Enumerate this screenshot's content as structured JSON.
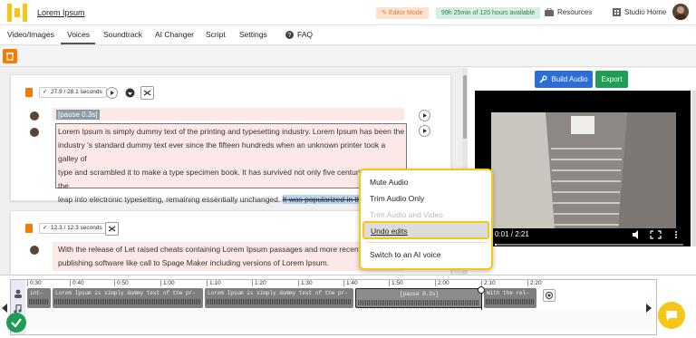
{
  "header": {
    "app_name": "Lorem Ipsum",
    "editor_mode": "Editor Mode",
    "hours_available": "99h 25min of 120 hours available",
    "resources": "Resources",
    "studio_home": "Studio Home"
  },
  "nav": {
    "tabs": [
      "Video/Images",
      "Voices",
      "Soundtrack",
      "AI Changer",
      "Script",
      "Settings",
      "FAQ"
    ],
    "active": "Voices"
  },
  "toolbar": {
    "build_audio": "Build Audio",
    "export": "Export"
  },
  "blocks": [
    {
      "duration": "27.9 / 28.1 seconds",
      "pause_tag": "[pause 0.3s]",
      "lines": [
        "Lorem Ipsum is simply dummy text of the printing and typesetting industry. Lorem Ipsum has been the",
        "industry 's standard dummy text ever since the fifteen hundreds when an unknown printer took a galley of",
        "type and scrambled it to make a type specimen book. It has survived not only five centuries, but also the",
        "leap into electronic typesetting, remaining essentially unchanged."
      ],
      "selected_text": "It was popularized in the nineteen sixt"
    },
    {
      "duration": "12.3 / 12.3 seconds",
      "lines": [
        "With the release of Let raised cheats containing Lorem Ipsum passages and more recently with",
        "publishing software like call to Spage Maker including versions of Lorem Ipsum."
      ]
    }
  ],
  "video": {
    "time": "0:01 / 2:21"
  },
  "context_menu": {
    "items": [
      "Mute Audio",
      "Trim Audio Only",
      "Trim Audio and Video",
      "Undo edits",
      "Switch to an AI voice"
    ],
    "disabled": "Trim Audio and Video",
    "highlighted": "Undo edits"
  },
  "timeline": {
    "ticks": [
      "0:30",
      "0:40",
      "0:50",
      "1:00",
      "1:10",
      "1:20",
      "1:30",
      "1:40",
      "1:50",
      "2:00",
      "2:10",
      "2:20"
    ],
    "clips": [
      {
        "label": "int-"
      },
      {
        "label": "Lorem Ipsum is simply dummy text of the pr-"
      },
      {
        "label": "Lorem Ipsum is simply dummy text of the pr-"
      },
      {
        "label": "[pause 0.3s]"
      },
      {
        "label": "With the rel-"
      }
    ]
  },
  "colors": {
    "accent": "#f5c518",
    "primary": "#2b6fd6",
    "success": "#1f9d55",
    "warning": "#f57c00"
  }
}
